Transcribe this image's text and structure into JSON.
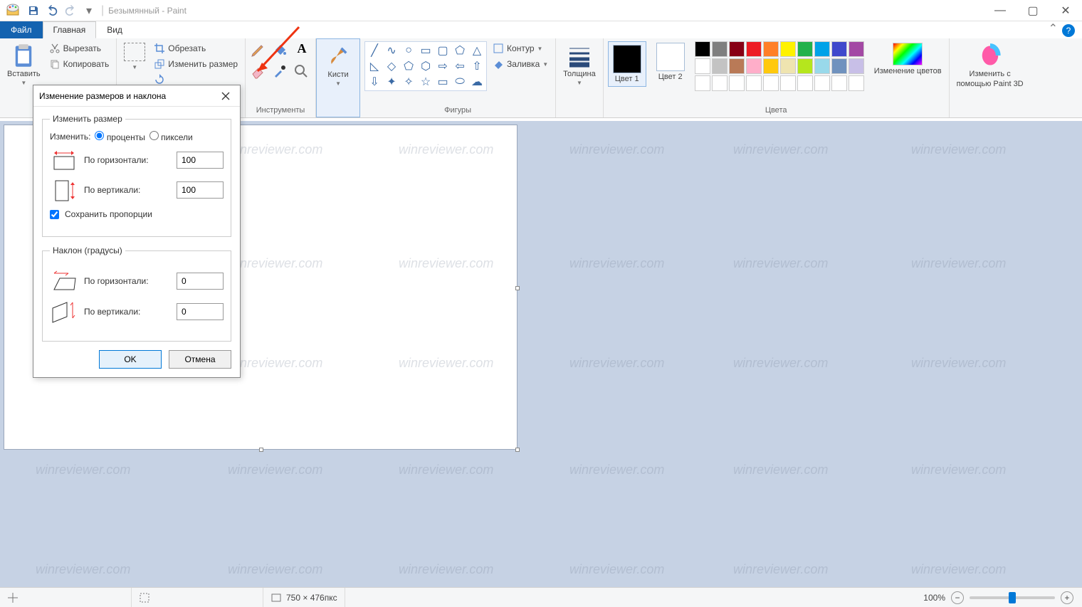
{
  "window": {
    "title": "Безымянный - Paint",
    "min": "—",
    "max": "▢",
    "close": "✕"
  },
  "tabs": {
    "file": "Файл",
    "home": "Главная",
    "view": "Вид"
  },
  "ribbon": {
    "clipboard": {
      "paste": "Вставить",
      "cut": "Вырезать",
      "copy": "Копировать",
      "group": ""
    },
    "image": {
      "select": "",
      "crop": "Обрезать",
      "resize": "Изменить размер",
      "rotate": ""
    },
    "tools": {
      "group": "Инструменты"
    },
    "brushes": {
      "label": "Кисти"
    },
    "shapes": {
      "group": "Фигуры",
      "outline": "Контур",
      "fill": "Заливка"
    },
    "thickness": "Толщина",
    "color1": "Цвет 1",
    "color2": "Цвет 2",
    "editcolors": "Изменение цветов",
    "colors_group": "Цвета",
    "paint3d_l1": "Изменить с",
    "paint3d_l2": "помощью Paint 3D"
  },
  "palette": {
    "row1": [
      "#000000",
      "#7f7f7f",
      "#880015",
      "#ed1c24",
      "#ff7f27",
      "#fff200",
      "#22b14c",
      "#00a2e8",
      "#3f48cc",
      "#a349a4"
    ],
    "row2": [
      "#ffffff",
      "#c3c3c3",
      "#b97a57",
      "#ffaec9",
      "#ffc90e",
      "#efe4b0",
      "#b5e61d",
      "#99d9ea",
      "#7092be",
      "#c8bfe7"
    ],
    "row3": [
      "#ffffff",
      "#ffffff",
      "#ffffff",
      "#ffffff",
      "#ffffff",
      "#ffffff",
      "#ffffff",
      "#ffffff",
      "#ffffff",
      "#ffffff"
    ]
  },
  "dialog": {
    "title": "Изменение размеров и наклона",
    "resize_legend": "Изменить размер",
    "by_label": "Изменить:",
    "percent": "проценты",
    "pixels": "пиксели",
    "horiz": "По горизонтали:",
    "vert": "По вертикали:",
    "h_val": "100",
    "v_val": "100",
    "keep": "Сохранить пропорции",
    "skew_legend": "Наклон (градусы)",
    "sk_h": "0",
    "sk_v": "0",
    "ok": "OK",
    "cancel": "Отмена"
  },
  "status": {
    "dims": "750 × 476пкс",
    "zoom": "100%"
  },
  "watermark": "winreviewer.com"
}
